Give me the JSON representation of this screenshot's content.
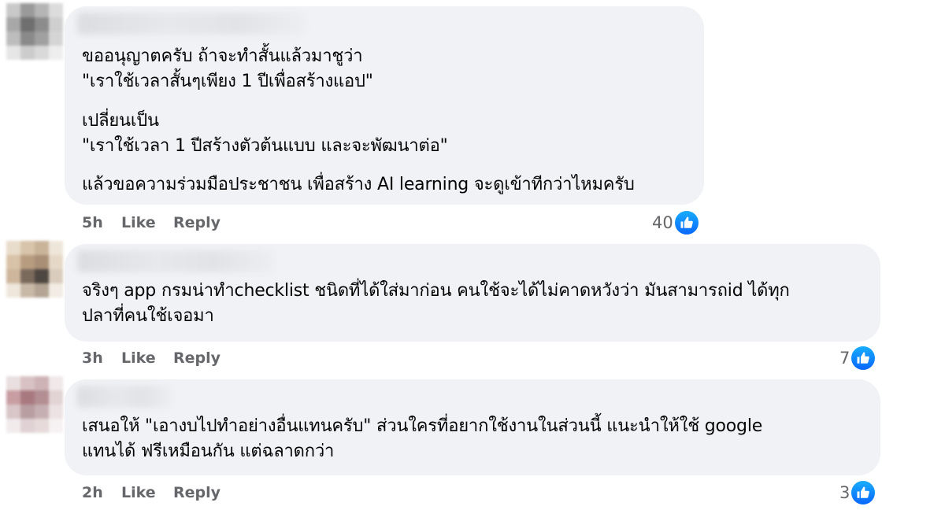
{
  "comments": [
    {
      "paragraphs": [
        "ขออนุญาตครับ ถ้าจะทำสั้นแล้วมาชูว่า\n\"เราใช้เวลาสั้นๆเพียง 1 ปีเพื่อสร้างแอป\"",
        "เปลี่ยนเป็น\n\"เราใช้เวลา 1 ปีสร้างตัวต้นแบบ และจะพัฒนาต่อ\"",
        "แล้วขอความร่วมมือประชาชน เพื่อสร้าง AI learning จะดูเข้าทีกว่าไหมครับ"
      ],
      "time": "5h",
      "like_label": "Like",
      "reply_label": "Reply",
      "reaction_count": "40",
      "avatar_colors": [
        "#c9c9c9",
        "#9a9a9a",
        "#b5b5b5",
        "#dcdcdc",
        "#a8a8a8",
        "#6f6f6f",
        "#8c8c8c",
        "#cfcfcf",
        "#bdbdbd",
        "#8a8a8a",
        "#a0a0a0",
        "#d5d5d5",
        "#e6e6e6",
        "#cccccc",
        "#d9d9d9",
        "#eeeeee"
      ]
    },
    {
      "paragraphs": [
        "จริงๆ app กรมน่าทำchecklist ชนิดที่ได้ใส่มาก่อน คนใช้จะได้ไม่คาดหวังว่า มันสามารถid ได้ทุก\nปลาที่คนใช้เจอมา"
      ],
      "time": "3h",
      "like_label": "Like",
      "reply_label": "Reply",
      "reaction_count": "7",
      "avatar_colors": [
        "#e8dccb",
        "#d8c4aa",
        "#c9b49a",
        "#efe6da",
        "#d9c3a8",
        "#b89c80",
        "#a98f76",
        "#e6d8c6",
        "#cdb69c",
        "#7a6a5c",
        "#4e4640",
        "#d9ccbd",
        "#efe7dc",
        "#c8b8a6",
        "#b3a493",
        "#f2ece4"
      ]
    },
    {
      "paragraphs": [
        "เสนอให้ \"เอางบไปทำอย่างอื่นแทนครับ\" ส่วนใครที่อยากใช้งานในส่วนนี้ แนะนำให้ใช้ google\nแทนได้ ฟรีเหมือนกัน แต่ฉลาดกว่า"
      ],
      "time": "2h",
      "like_label": "Like",
      "reply_label": "Reply",
      "reaction_count": "3",
      "avatar_colors": [
        "#e9dfe0",
        "#d9c2c4",
        "#cdb3b6",
        "#f0e8e9",
        "#c99ea3",
        "#a87a80",
        "#b38e92",
        "#e2d3d5",
        "#d8c6c8",
        "#b89ea1",
        "#c6afb2",
        "#ece2e3",
        "#f1ebec",
        "#e0d2d4",
        "#e6dadb",
        "#f6f1f2"
      ]
    }
  ],
  "colors": {
    "bubble": "#f0f2f5",
    "meta_text": "#65676b",
    "like_blue": "#0866ff"
  }
}
